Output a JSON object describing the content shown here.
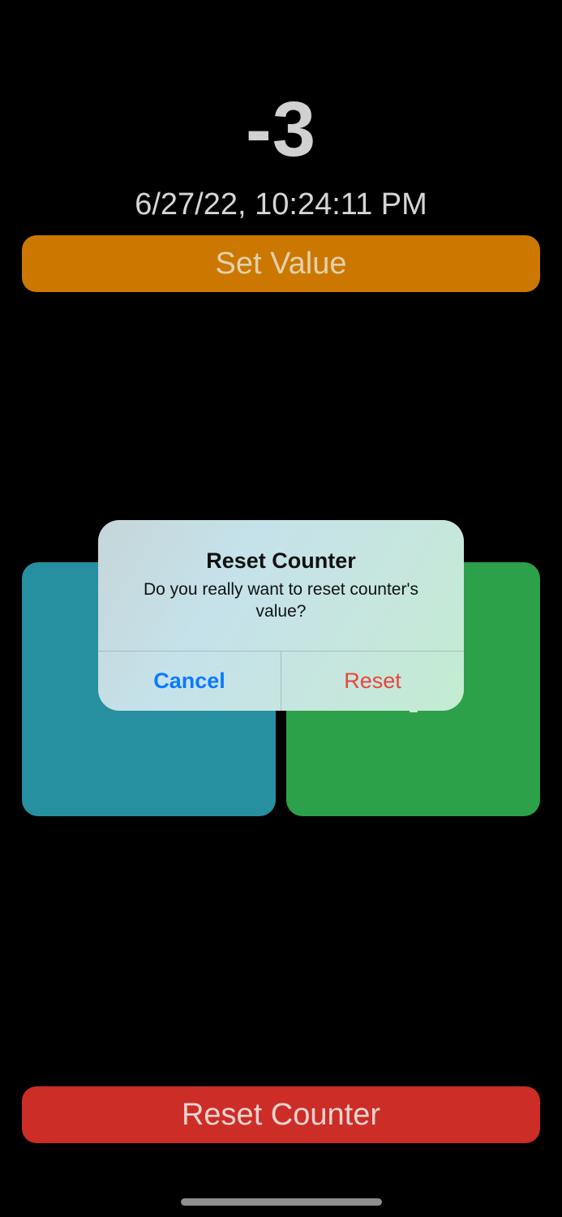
{
  "counter": {
    "value": "-3",
    "timestamp": "6/27/22, 10:24:11 PM"
  },
  "buttons": {
    "set_value": "Set Value",
    "reset_counter": "Reset Counter"
  },
  "alert": {
    "title": "Reset Counter",
    "message": "Do you really want to reset counter's value?",
    "cancel_label": "Cancel",
    "reset_label": "Reset"
  },
  "colors": {
    "set_value_bg": "#cc7800",
    "decrement_tile_bg": "#268fa0",
    "increment_tile_bg": "#2da04a",
    "reset_counter_bg": "#cc2d26",
    "cancel_text": "#0a7aff",
    "reset_text": "#e8453a"
  }
}
